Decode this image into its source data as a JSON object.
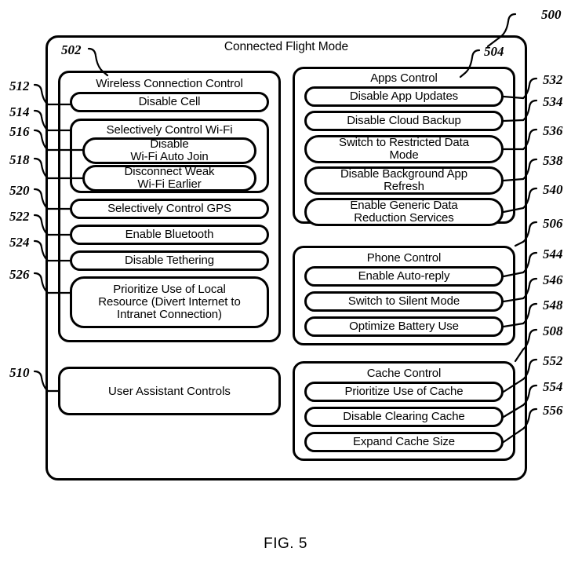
{
  "figure": {
    "caption": "FIG. 5",
    "root_ref": "500",
    "title": "Connected Flight Mode"
  },
  "colors": {
    "ink": "#000000",
    "paper": "#ffffff"
  },
  "left_column": {
    "wireless": {
      "ref": "502",
      "title": "Wireless Connection Control",
      "items": [
        {
          "ref": "512",
          "label": "Disable Cell"
        }
      ],
      "wifi_group": {
        "ref": "514",
        "title": "Selectively Control Wi-Fi",
        "items": [
          {
            "ref": "516",
            "label": "Disable\nWi-Fi Auto Join"
          },
          {
            "ref": "518",
            "label": "Disconnect Weak\nWi-Fi Earlier"
          }
        ]
      },
      "items_after": [
        {
          "ref": "520",
          "label": "Selectively Control GPS"
        },
        {
          "ref": "522",
          "label": "Enable Bluetooth"
        },
        {
          "ref": "524",
          "label": "Disable Tethering"
        },
        {
          "ref": "526",
          "label": "Prioritize Use of Local\nResource (Divert Internet to\nIntranet Connection)"
        }
      ]
    },
    "user_assistant": {
      "ref": "510",
      "label": "User Assistant Controls"
    }
  },
  "right_column": {
    "apps": {
      "ref": "504",
      "title": "Apps Control",
      "items": [
        {
          "ref": "532",
          "label": "Disable App Updates"
        },
        {
          "ref": "534",
          "label": "Disable Cloud Backup"
        },
        {
          "ref": "536",
          "label": "Switch to Restricted Data\nMode"
        },
        {
          "ref": "538",
          "label": "Disable Background App\nRefresh"
        },
        {
          "ref": "540",
          "label": "Enable Generic Data\nReduction Services"
        }
      ]
    },
    "phone": {
      "ref": "506",
      "title": "Phone Control",
      "items": [
        {
          "ref": "544",
          "label": "Enable Auto-reply"
        },
        {
          "ref": "546",
          "label": "Switch to Silent Mode"
        },
        {
          "ref": "548",
          "label": "Optimize Battery Use"
        }
      ]
    },
    "cache": {
      "ref": "508",
      "title": "Cache Control",
      "items": [
        {
          "ref": "552",
          "label": "Prioritize Use of Cache"
        },
        {
          "ref": "554",
          "label": "Disable Clearing Cache"
        },
        {
          "ref": "556",
          "label": "Expand Cache Size"
        }
      ]
    }
  }
}
